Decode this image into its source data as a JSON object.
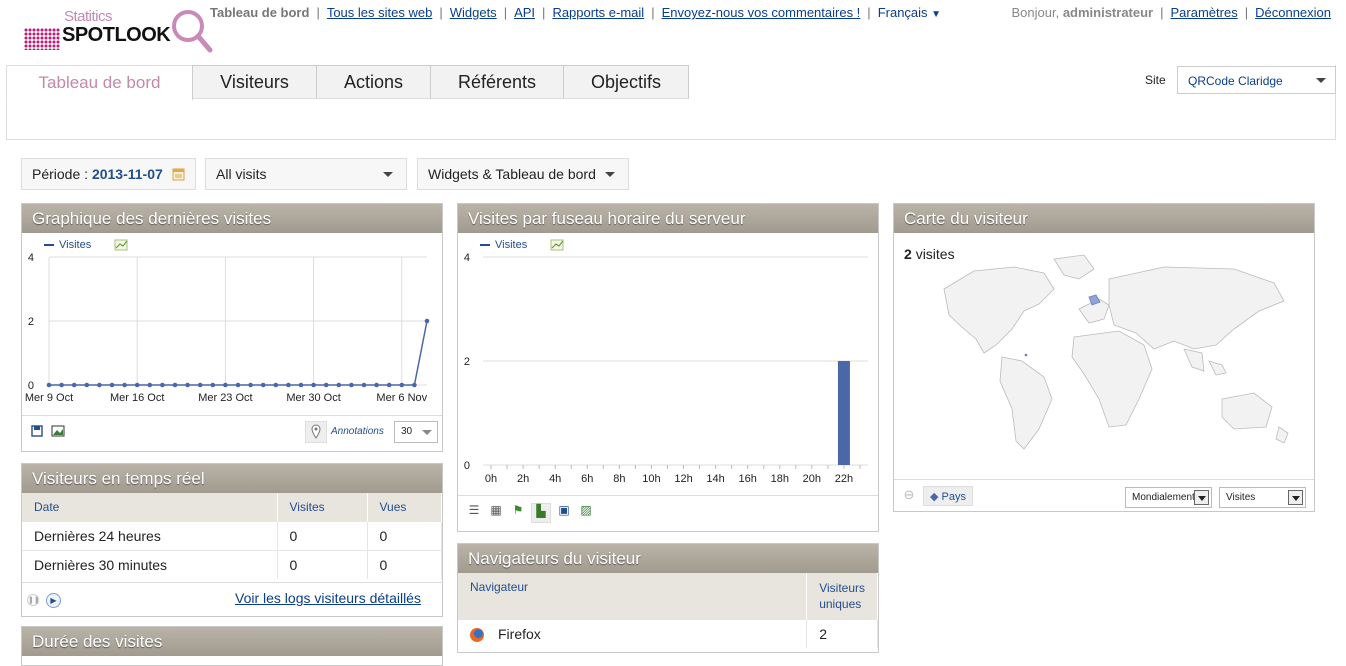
{
  "brand": {
    "top": "Statitics",
    "name": "SPOTLOOK"
  },
  "nav": {
    "current": "Tableau de bord",
    "links": [
      "Tous les sites web",
      "Widgets",
      "API",
      "Rapports e-mail",
      "Envoyez-nous vos commentaires !"
    ],
    "language": "Français"
  },
  "user": {
    "greeting": "Bonjour,",
    "name": "administrateur",
    "settings": "Paramètres",
    "logout": "Déconnexion"
  },
  "tabs": [
    "Tableau de bord",
    "Visiteurs",
    "Actions",
    "Référents",
    "Objectifs"
  ],
  "site": {
    "label": "Site",
    "value": "QRCode Claridge"
  },
  "filters": {
    "period_label": "Période :",
    "period_value": "2013-11-07",
    "segment": "All visits",
    "dashboard": "Widgets & Tableau de bord"
  },
  "widget_visits": {
    "title": "Graphique des dernières visites",
    "legend": "Visites",
    "annotations": "Annotations",
    "limit": "30"
  },
  "widget_tz": {
    "title": "Visites par fuseau horaire du serveur",
    "legend": "Visites"
  },
  "widget_map": {
    "title": "Carte du visiteur",
    "count": "2",
    "count_label": "visites",
    "mode_button": "Pays",
    "scope": "Mondialement",
    "metric": "Visites"
  },
  "widget_realtime": {
    "title": "Visiteurs en temps réel",
    "headers": [
      "Date",
      "Visites",
      "Vues"
    ],
    "rows": [
      [
        "Dernières 24 heures",
        "0",
        "0"
      ],
      [
        "Dernières 30 minutes",
        "0",
        "0"
      ]
    ],
    "logs_link": "Voir les logs visiteurs détaillés"
  },
  "widget_duration": {
    "title": "Durée des visites"
  },
  "widget_browsers": {
    "title": "Navigateurs du visiteur",
    "headers": [
      "Navigateur",
      "Visiteurs uniques"
    ],
    "rows": [
      [
        "Firefox",
        "2"
      ]
    ]
  },
  "chart_data": [
    {
      "type": "line",
      "series": [
        {
          "name": "Visites",
          "values": [
            0,
            0,
            0,
            0,
            0,
            0,
            0,
            0,
            0,
            0,
            0,
            0,
            0,
            0,
            0,
            0,
            0,
            0,
            0,
            0,
            0,
            0,
            0,
            0,
            0,
            0,
            0,
            0,
            0,
            0,
            2
          ]
        }
      ],
      "x_tick_labels": [
        "Mer 9 Oct",
        "Mer 16 Oct",
        "Mer 23 Oct",
        "Mer 30 Oct",
        "Mer 6 Nov"
      ],
      "y_ticks": [
        0,
        2,
        4
      ],
      "ylim": [
        0,
        4
      ]
    },
    {
      "type": "bar",
      "categories": [
        "0h",
        "1h",
        "2h",
        "3h",
        "4h",
        "5h",
        "6h",
        "7h",
        "8h",
        "9h",
        "10h",
        "11h",
        "12h",
        "13h",
        "14h",
        "15h",
        "16h",
        "17h",
        "18h",
        "19h",
        "20h",
        "21h",
        "22h",
        "23h"
      ],
      "x_tick_labels": [
        "0h",
        "2h",
        "4h",
        "6h",
        "8h",
        "10h",
        "12h",
        "14h",
        "16h",
        "18h",
        "20h",
        "22h"
      ],
      "series": [
        {
          "name": "Visites",
          "values": [
            0,
            0,
            0,
            0,
            0,
            0,
            0,
            0,
            0,
            0,
            0,
            0,
            0,
            0,
            0,
            0,
            0,
            0,
            0,
            0,
            0,
            0,
            2,
            0
          ]
        }
      ],
      "y_ticks": [
        0,
        2,
        4
      ],
      "ylim": [
        0,
        4
      ]
    }
  ],
  "colors": {
    "accent": "#c189ae",
    "link": "#0a3e8a",
    "series": "#4a67a8",
    "header": "#a9a296"
  }
}
